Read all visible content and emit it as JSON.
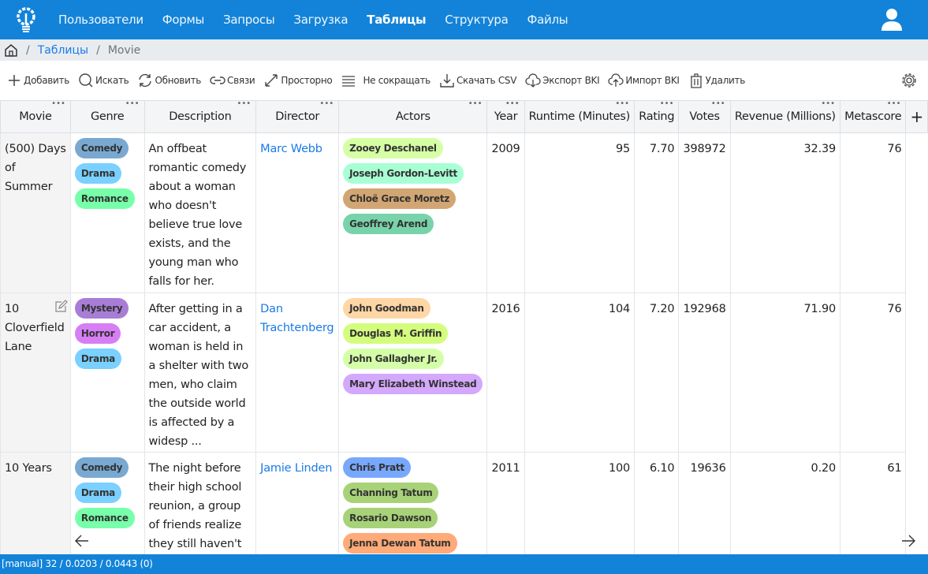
{
  "nav": {
    "items": [
      "Пользователи",
      "Формы",
      "Запросы",
      "Загрузка",
      "Таблицы",
      "Структура",
      "Файлы"
    ],
    "active": "Таблицы"
  },
  "breadcrumb": {
    "parent": "Таблицы",
    "current": "Movie"
  },
  "toolbar": {
    "add": "Добавить",
    "search": "Искать",
    "refresh": "Обновить",
    "links": "Связи",
    "spacious": "Просторно",
    "nowrap": "Не сокращать",
    "csv": "Скачать CSV",
    "export": "Экспорт BKI",
    "import": "Импорт BKI",
    "delete": "Удалить"
  },
  "columns": [
    "Movie",
    "Genre",
    "Description",
    "Director",
    "Actors",
    "Year",
    "Runtime (Minutes)",
    "Rating",
    "Votes",
    "Revenue (Millions)",
    "Metascore"
  ],
  "add_column": "+",
  "rows": [
    {
      "movie": "(500) Days of Summer",
      "genres": [
        {
          "name": "Comedy",
          "color": "#79a9d1"
        },
        {
          "name": "Drama",
          "color": "#7ad0ff"
        },
        {
          "name": "Romance",
          "color": "#77ffaa"
        }
      ],
      "description": "An offbeat romantic comedy about a woman who doesn't believe true love exists, and the young man who falls for her.",
      "director": "Marc Webb",
      "actors": [
        {
          "name": "Zooey Deschanel",
          "color": "#d6ffa5"
        },
        {
          "name": "Joseph Gordon-Levitt",
          "color": "#a8ffd4"
        },
        {
          "name": "Chloë Grace Moretz",
          "color": "#d2a673"
        },
        {
          "name": "Geoffrey Arend",
          "color": "#78d3aa"
        }
      ],
      "year": "2009",
      "runtime": "95",
      "rating": "7.70",
      "votes": "398972",
      "revenue": "32.39",
      "metascore": "76"
    },
    {
      "movie": "10 Cloverfield Lane",
      "genres": [
        {
          "name": "Mystery",
          "color": "#a87dd6"
        },
        {
          "name": "Horror",
          "color": "#d77ef5"
        },
        {
          "name": "Drama",
          "color": "#7ad0ff"
        }
      ],
      "description": "After getting in a car accident, a woman is held in a shelter with two men, who claim the outside world is affected by a widesp ...",
      "director": "Dan Trachtenberg",
      "actors": [
        {
          "name": "John Goodman",
          "color": "#ffd6a5"
        },
        {
          "name": "Douglas M. Griffin",
          "color": "#d4fd7e"
        },
        {
          "name": "John Gallagher Jr.",
          "color": "#d4ffa8"
        },
        {
          "name": "Mary Elizabeth Winstead",
          "color": "#d4a8fd"
        }
      ],
      "year": "2016",
      "runtime": "104",
      "rating": "7.20",
      "votes": "192968",
      "revenue": "71.90",
      "metascore": "76"
    },
    {
      "movie": "10 Years",
      "genres": [
        {
          "name": "Comedy",
          "color": "#79a9d1"
        },
        {
          "name": "Drama",
          "color": "#7ad0ff"
        },
        {
          "name": "Romance",
          "color": "#77ffaa"
        }
      ],
      "description": "The night before their high school reunion, a group of friends realize they still haven't",
      "director": "Jamie Linden",
      "actors": [
        {
          "name": "Chris Pratt",
          "color": "#78a8fd"
        },
        {
          "name": "Channing Tatum",
          "color": "#a8d278"
        },
        {
          "name": "Rosario Dawson",
          "color": "#a8d278"
        },
        {
          "name": "Jenna Dewan Tatum",
          "color": "#ffaa78"
        }
      ],
      "year": "2011",
      "runtime": "100",
      "rating": "6.10",
      "votes": "19636",
      "revenue": "0.20",
      "metascore": "61"
    }
  ],
  "status": "[manual] 32 / 0.0203 / 0.0443 (0)"
}
